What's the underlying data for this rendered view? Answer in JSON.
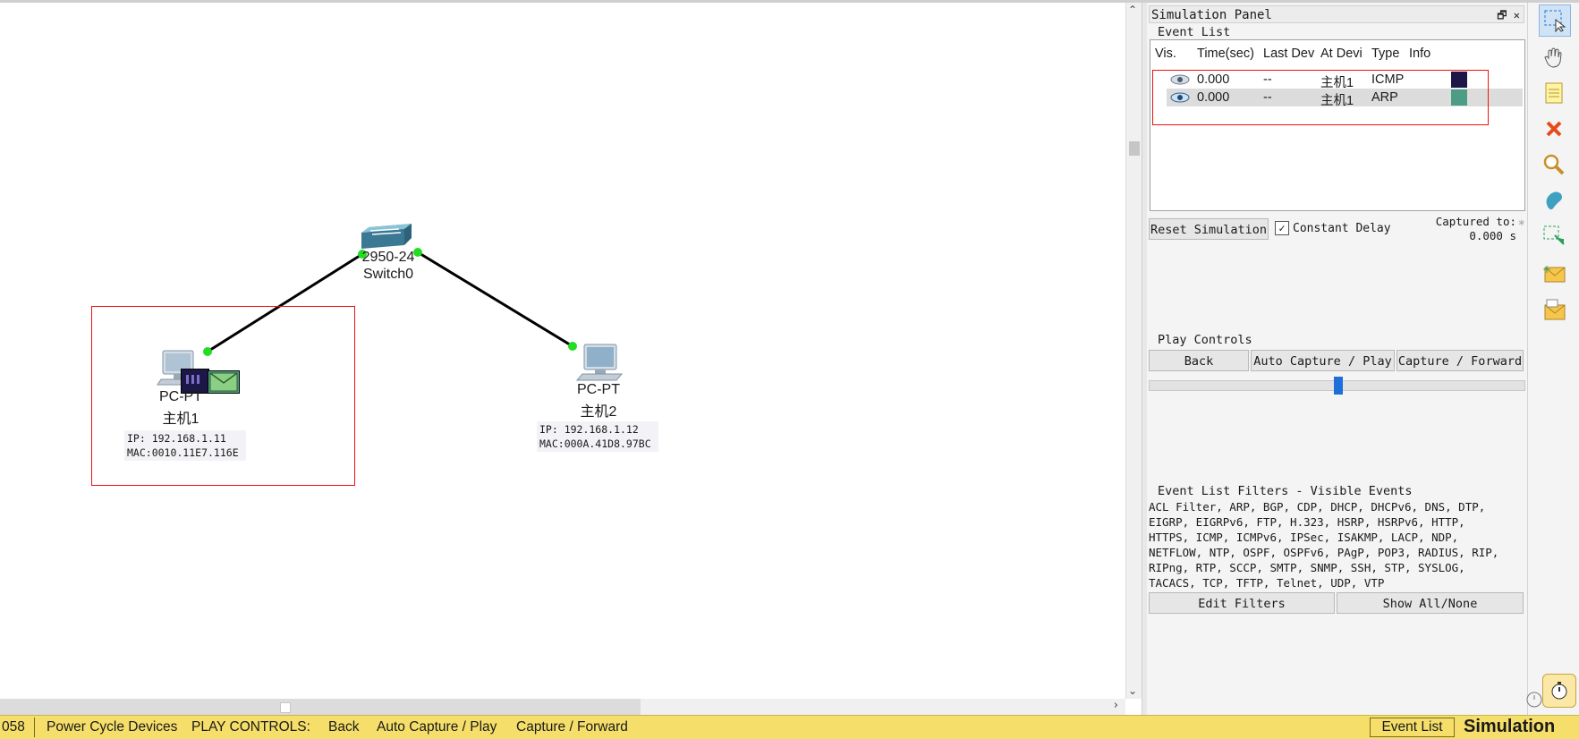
{
  "canvas": {
    "switch": {
      "model": "2950-24",
      "name": "Switch0"
    },
    "pc1": {
      "type": "PC-PT",
      "name": "主机1",
      "ip": "IP: 192.168.1.11",
      "mac": "MAC:0010.11E7.116E"
    },
    "pc2": {
      "type": "PC-PT",
      "name": "主机2",
      "ip": "IP: 192.168.1.12",
      "mac": "MAC:000A.41D8.97BC"
    }
  },
  "panel": {
    "title": "Simulation Panel",
    "window_controls": "🗗 ✕",
    "event_list_label": "Event List",
    "columns": [
      "Vis.",
      "Time(sec)",
      "Last Dev",
      "At Devi",
      "Type",
      "Info"
    ],
    "events": [
      {
        "time": "0.000",
        "last_dev": "--",
        "at_dev": "主机1",
        "type": "ICMP",
        "info_color": "#1d1748"
      },
      {
        "time": "0.000",
        "last_dev": "--",
        "at_dev": "主机1",
        "type": "ARP",
        "info_color": "#4f9c86"
      }
    ],
    "reset_button": "Reset Simulation",
    "constant_delay_label": "Constant Delay",
    "constant_delay_checked": true,
    "captured_label": "Captured to:",
    "captured_value": "0.000 s",
    "play_controls_label": "Play Controls",
    "back_button": "Back",
    "auto_capture_button": "Auto Capture / Play",
    "capture_forward_button": "Capture / Forward",
    "filters_label": "Event List Filters - Visible Events",
    "filters_lines": [
      "ACL Filter, ARP, BGP, CDP, DHCP, DHCPv6, DNS, DTP,",
      "EIGRP, EIGRPv6, FTP, H.323, HSRP, HSRPv6, HTTP,",
      "HTTPS, ICMP, ICMPv6, IPSec, ISAKMP, LACP, NDP,",
      "NETFLOW, NTP, OSPF, OSPFv6, PAgP, POP3, RADIUS, RIP,",
      "RIPng, RTP, SCCP, SMTP, SNMP, SSH, STP, SYSLOG,",
      "TACACS, TCP, TFTP, Telnet, UDP, VTP"
    ],
    "edit_filters_button": "Edit Filters",
    "show_all_button": "Show All/None"
  },
  "toolbar": [
    "select-icon",
    "hand-icon",
    "note-icon",
    "delete-icon",
    "zoom-icon",
    "shape-icon",
    "resize-icon",
    "add-simple-pdu-icon",
    "add-complex-pdu-icon"
  ],
  "status": {
    "time_fragment": "058",
    "power_cycle": "Power Cycle Devices",
    "play_controls": "PLAY CONTROLS:",
    "back": "Back",
    "auto_capture": "Auto Capture / Play",
    "capture_forward": "Capture / Forward",
    "event_list": "Event List",
    "simulation": "Simulation"
  }
}
